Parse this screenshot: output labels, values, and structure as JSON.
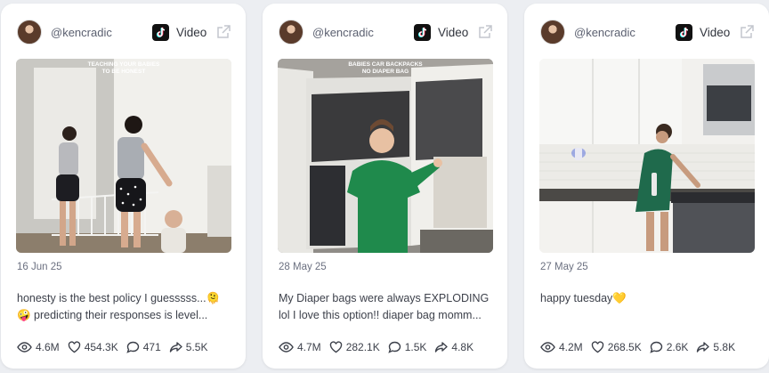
{
  "cards": [
    {
      "handle": "@kencradic",
      "type_label": "Video",
      "thumb_text": "TEACHING YOUR BABIES TO BE HONEST",
      "date": "16 Jun 25",
      "caption": "honesty is the best policy I guesssss...🫠 🤪 predicting their responses is level...",
      "views": "4.6M",
      "likes": "454.3K",
      "comments": "471",
      "shares": "5.5K"
    },
    {
      "handle": "@kencradic",
      "type_label": "Video",
      "thumb_text": "BABIES CAR BACKPACKS NO DIAPER BAG",
      "date": "28 May 25",
      "caption": "My Diaper bags were always EXPLODING lol I love this option!! diaper bag momm...",
      "views": "4.7M",
      "likes": "282.1K",
      "comments": "1.5K",
      "shares": "4.8K"
    },
    {
      "handle": "@kencradic",
      "type_label": "Video",
      "thumb_text": "",
      "date": "27 May 25",
      "caption": "happy tuesday💛",
      "views": "4.2M",
      "likes": "268.5K",
      "comments": "2.6K",
      "shares": "5.8K"
    }
  ],
  "icons": {
    "platform": "tiktok-icon",
    "open": "external-link-icon",
    "views": "eye-icon",
    "likes": "heart-icon",
    "comments": "comment-icon",
    "shares": "share-icon"
  },
  "colors": {
    "page_bg": "#eceef2",
    "card_bg": "#ffffff",
    "text": "#3d414b",
    "muted": "#6b7080"
  }
}
